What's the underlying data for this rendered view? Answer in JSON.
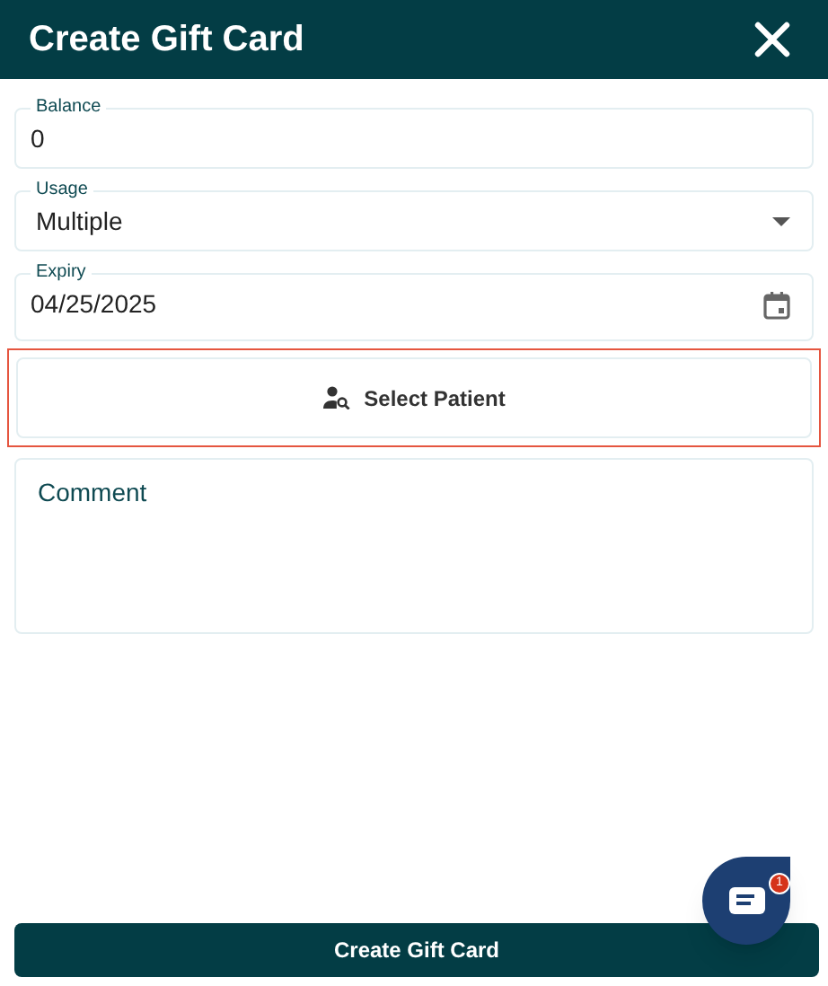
{
  "window": {
    "title": "Create Gift Card"
  },
  "fields": [
    {
      "kind": "text",
      "label": "Balance",
      "value": "0"
    },
    {
      "kind": "select",
      "label": "Usage",
      "value": "Multiple"
    },
    {
      "kind": "date",
      "label": "Expiry",
      "value": "04/25/2025"
    }
  ],
  "select_patient": {
    "label": "Select Patient",
    "highlighted": true
  },
  "comment": {
    "placeholder": "Comment"
  },
  "submit": {
    "label": "Create Gift Card"
  },
  "chat": {
    "badge": "1"
  }
}
